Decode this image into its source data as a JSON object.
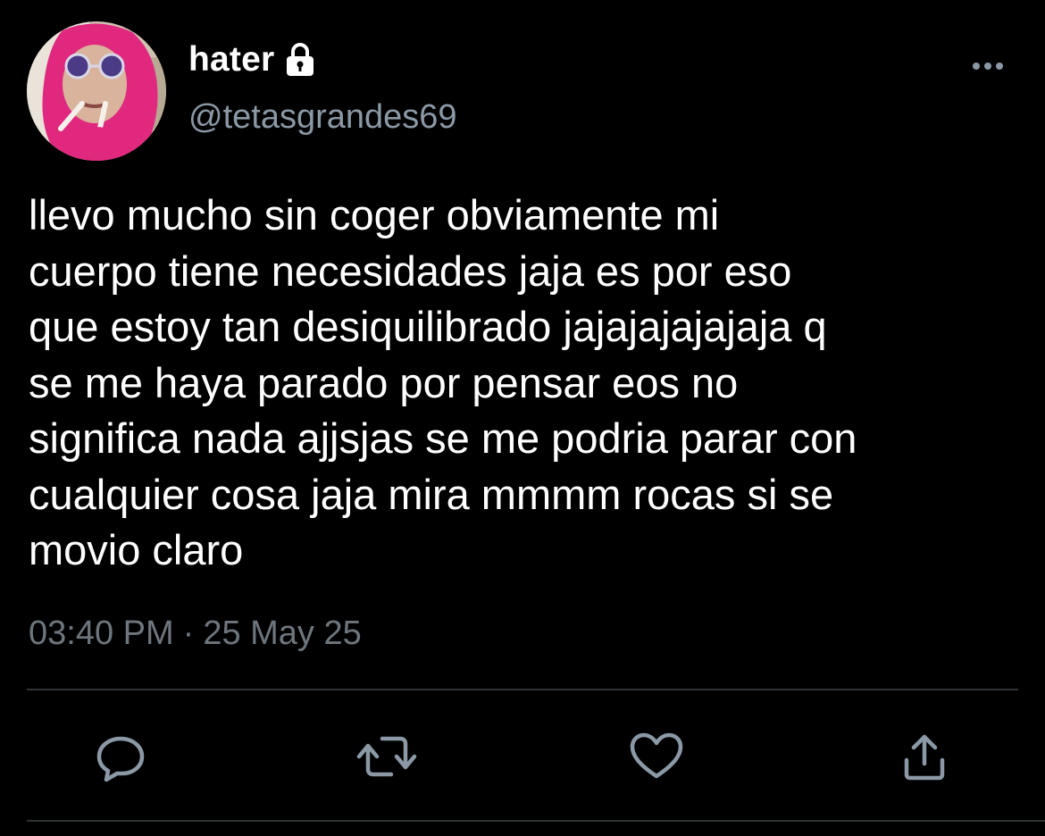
{
  "author": {
    "display_name": "hater",
    "handle": "@tetasgrandes69",
    "protected_icon": "lock-icon",
    "avatar_icon": "avatar-photo"
  },
  "tweet": {
    "text": "llevo mucho sin coger obviamente mi\ncuerpo tiene necesidades jaja es por eso\nque estoy tan desiquilibrado jajajajajajaja q\nse me haya parado por pensar eos no\nsignifica nada ajjsjas se me podria parar con\ncualquier cosa jaja mira mmmm rocas si se\nmovio claro",
    "time": "03:40 PM",
    "separator": "·",
    "date": "25 May 25"
  },
  "actions": [
    {
      "name": "reply",
      "icon": "reply-icon"
    },
    {
      "name": "retweet",
      "icon": "retweet-icon"
    },
    {
      "name": "like",
      "icon": "heart-icon"
    },
    {
      "name": "share",
      "icon": "share-icon"
    }
  ],
  "more_icon": "more-horizontal-icon",
  "colors": {
    "background": "#000000",
    "primary_text": "#ffffff",
    "secondary_text": "#8b98a5",
    "meta_text": "#6e767d",
    "icon": "#8b98a5",
    "divider": "#2f3336"
  }
}
